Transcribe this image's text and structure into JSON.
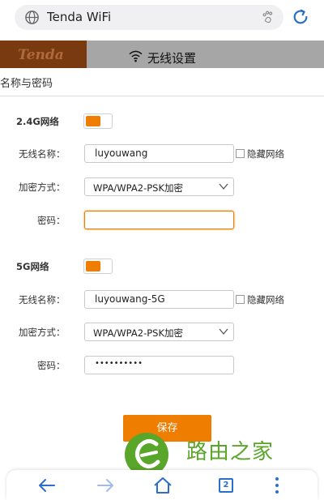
{
  "browser": {
    "url_text": "Tenda WiFi",
    "tab_count": "2"
  },
  "router": {
    "logo": "Tenda",
    "header_title": "无线设置"
  },
  "dialog": {
    "title": "名称与密码",
    "band_24": {
      "label": "2.4G网络",
      "enabled": true,
      "ssid_label": "无线名称：",
      "ssid_value": "luyouwang",
      "hide_label": "隐藏网络",
      "hide_checked": false,
      "security_label": "加密方式：",
      "security_value": "WPA/WPA2-PSK加密",
      "password_label": "密码：",
      "password_value": ""
    },
    "band_5": {
      "label": "5G网络",
      "enabled": true,
      "ssid_label": "无线名称：",
      "ssid_value": "luyouwang-5G",
      "hide_label": "隐藏网络",
      "hide_checked": false,
      "security_label": "加密方式：",
      "security_value": "WPA/WPA2-PSK加密",
      "password_label": "密码：",
      "password_value": "••••••••••"
    },
    "save_label": "保存"
  },
  "watermark": {
    "text": "路由之家"
  },
  "colors": {
    "accent": "#ef7d00",
    "header_gray": "#a6a6a6",
    "logo_brown": "#7a3a0f",
    "watermark_green": "#5aa62a",
    "browser_blue": "#2a6fc9"
  },
  "icons": {
    "url": "globe-icon",
    "paw": "paw-icon",
    "refresh": "refresh-icon",
    "wifi": "wifi-icon",
    "back": "back-arrow-icon",
    "forward": "forward-arrow-icon",
    "home": "home-icon",
    "menu": "more-menu-icon"
  }
}
